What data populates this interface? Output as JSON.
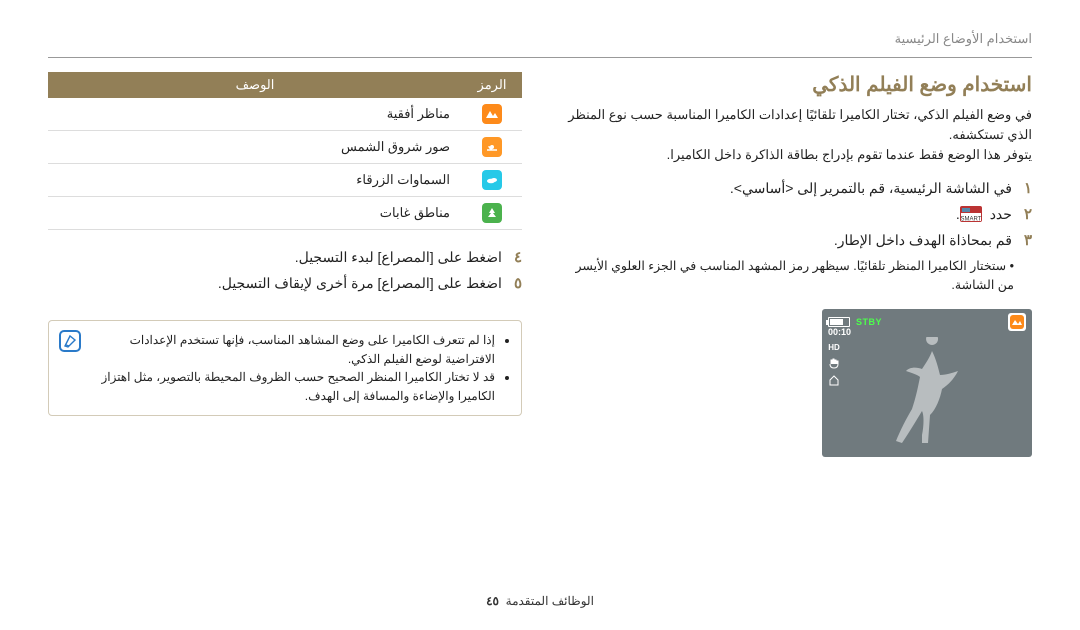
{
  "header": {
    "breadcrumb": "استخدام الأوضاع الرئيسية"
  },
  "title": "استخدام وضع الفيلم الذكي",
  "intro1": "في وضع الفيلم الذكي، تختار الكاميرا تلقائيًا إعدادات الكاميرا المناسبة حسب نوع المنظر الذي تستكشفه.",
  "intro2": "يتوفر هذا الوضع فقط عندما تقوم بإدراج بطاقة الذاكرة داخل الكاميرا.",
  "steps": {
    "s1_num": "١",
    "s1": "في الشاشة الرئيسية، قم بالتمرير إلى <أساسي>.",
    "s2_num": "٢",
    "s2": "حدد",
    "s3_num": "٣",
    "s3": "قم بمحاذاة الهدف داخل الإطار.",
    "s3_bullet": "ستختار الكاميرا المنظر تلقائيًا. سيظهر رمز المشهد المناسب في الجزء العلوي الأيسر من الشاشة.",
    "s4_num": "٤",
    "s4": "اضغط على [المصراع] لبدء التسجيل.",
    "s5_num": "٥",
    "s5": "اضغط على [المصراع] مرة أخرى لإيقاف التسجيل."
  },
  "preview": {
    "status": "STBY",
    "time": "00:10",
    "hd": "HD"
  },
  "table": {
    "th_icon": "الرمز",
    "th_desc": "الوصف",
    "r1": "مناظر أفقية",
    "r2": "صور شروق الشمس",
    "r3": "السماوات الزرقاء",
    "r4": "مناطق غابات"
  },
  "note": {
    "n1": "إذا لم تتعرف الكاميرا على وضع المشاهد المناسب، فإنها تستخدم الإعدادات الافتراضية لوضع الفيلم الذكي.",
    "n2": "قد لا تختار الكاميرا المنظر الصحيح حسب الظروف المحيطة بالتصوير، مثل اهتزاز الكاميرا والإضاءة والمسافة إلى الهدف."
  },
  "footer": {
    "page": "٤٥",
    "section": "الوظائف المتقدمة"
  }
}
